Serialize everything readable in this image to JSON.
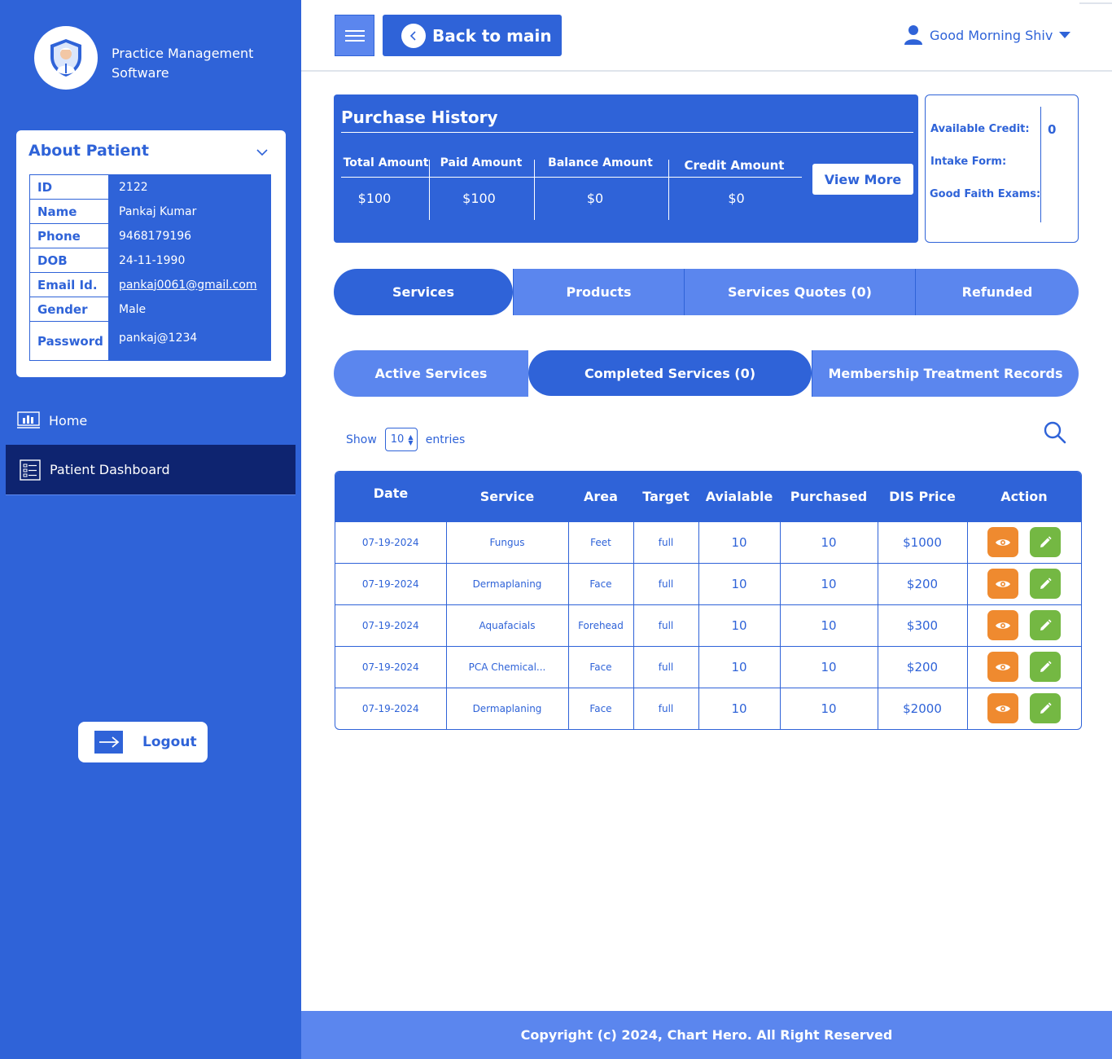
{
  "brand": {
    "line1": "Practice Management",
    "line2": "Software"
  },
  "about": {
    "title": "About Patient",
    "fields": [
      {
        "label": "ID",
        "value": "2122"
      },
      {
        "label": "Name",
        "value": "Pankaj Kumar"
      },
      {
        "label": "Phone",
        "value": "9468179196"
      },
      {
        "label": "DOB",
        "value": "24-11-1990"
      },
      {
        "label": "Email Id.",
        "value": "pankaj0061@gmail.com"
      },
      {
        "label": "Gender",
        "value": "Male"
      },
      {
        "label": "Password",
        "value": "pankaj@1234"
      }
    ]
  },
  "nav": {
    "home": "Home",
    "dashboard": "Patient Dashboard",
    "logout": "Logout"
  },
  "header": {
    "back": "Back to main",
    "greeting": "Good Morning Shiv"
  },
  "purchase": {
    "title": "Purchase History",
    "cols": [
      "Total Amount",
      "Paid Amount",
      "Balance Amount",
      "Credit Amount"
    ],
    "vals": [
      "$100",
      "$100",
      "$0",
      "$0"
    ],
    "view_more": "View More"
  },
  "credit": {
    "available_label": "Available Credit:",
    "intake_label": "Intake Form:",
    "faith_label": "Good Faith Exams:",
    "available_value": "0"
  },
  "main_tabs": [
    "Services",
    "Products",
    "Services Quotes (0)",
    "Refunded"
  ],
  "sub_tabs": [
    "Active Services",
    "Completed Services (0)",
    "Membership Treatment Records"
  ],
  "entries": {
    "show": "Show",
    "value": "10",
    "suffix": "entries"
  },
  "table": {
    "headers": [
      "Date",
      "Service",
      "Area",
      "Target",
      "Avialable",
      "Purchased",
      "DIS Price",
      "Action"
    ],
    "rows": [
      [
        "07-19-2024",
        "Fungus",
        "Feet",
        "full",
        "10",
        "10",
        "$1000"
      ],
      [
        "07-19-2024",
        "Dermaplaning",
        "Face",
        "full",
        "10",
        "10",
        "$200"
      ],
      [
        "07-19-2024",
        "Aquafacials",
        "Forehead",
        "full",
        "10",
        "10",
        "$300"
      ],
      [
        "07-19-2024",
        "PCA Chemical...",
        "Face",
        "full",
        "10",
        "10",
        "$200"
      ],
      [
        "07-19-2024",
        "Dermaplaning",
        "Face",
        "full",
        "10",
        "10",
        "$2000"
      ]
    ]
  },
  "footer": "Copyright (c) 2024, Chart Hero. All Right Reserved",
  "colors": {
    "primary": "#2f63d8",
    "light": "#5b86ee",
    "dark": "#0e2470",
    "orange": "#ef8a2f",
    "green": "#74b843"
  }
}
